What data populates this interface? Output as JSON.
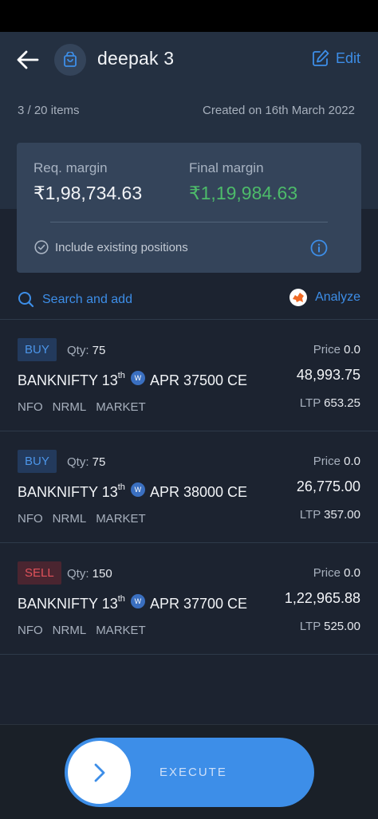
{
  "header": {
    "title": "deepak 3",
    "edit_label": "Edit",
    "items_count": "3 / 20 items",
    "created_on": "Created on 16th March 2022"
  },
  "margin": {
    "req_label": "Req. margin",
    "req_value": "₹1,98,734.63",
    "final_label": "Final margin",
    "final_value": "₹1,19,984.63",
    "include_label": "Include existing positions"
  },
  "actions": {
    "search_label": "Search and add",
    "analyze_label": "Analyze"
  },
  "labels": {
    "qty": "Qty: ",
    "price": "Price ",
    "ltp": "LTP ",
    "weekly_badge": "W"
  },
  "orders": [
    {
      "side": "BUY",
      "qty": "75",
      "symbol": "BANKNIFTY 13",
      "day_suffix": "th",
      "contract": "APR 37500 CE",
      "exchange": "NFO",
      "product": "NRML",
      "order_type": "MARKET",
      "price": "0.0",
      "value": "48,993.75",
      "ltp": "653.25"
    },
    {
      "side": "BUY",
      "qty": "75",
      "symbol": "BANKNIFTY 13",
      "day_suffix": "th",
      "contract": "APR 38000 CE",
      "exchange": "NFO",
      "product": "NRML",
      "order_type": "MARKET",
      "price": "0.0",
      "value": "26,775.00",
      "ltp": "357.00"
    },
    {
      "side": "SELL",
      "qty": "150",
      "symbol": "BANKNIFTY 13",
      "day_suffix": "th",
      "contract": "APR 37700 CE",
      "exchange": "NFO",
      "product": "NRML",
      "order_type": "MARKET",
      "price": "0.0",
      "value": "1,22,965.88",
      "ltp": "525.00"
    }
  ],
  "footer": {
    "execute_label": "EXECUTE"
  },
  "colors": {
    "accent": "#3d8ee8",
    "profit_green": "#4dbb6a",
    "sell_red": "#e1525b",
    "background": "#1c2330",
    "card": "#34445a"
  }
}
